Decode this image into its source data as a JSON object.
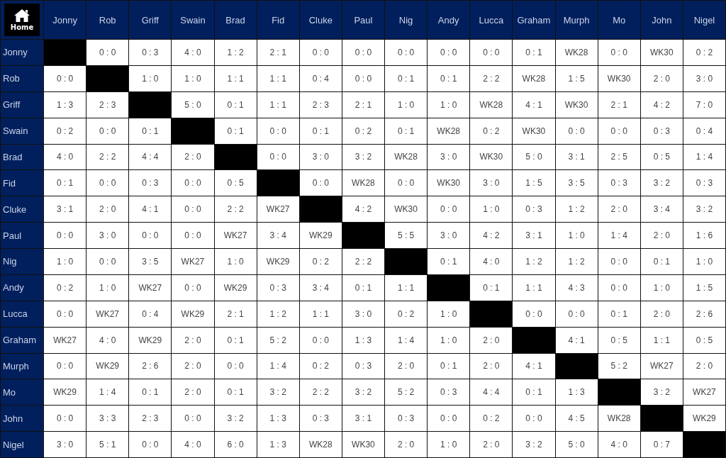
{
  "home_button": {
    "label": "Home"
  },
  "columns": [
    "Jonny",
    "Rob",
    "Griff",
    "Swain",
    "Brad",
    "Fid",
    "Cluke",
    "Paul",
    "Nig",
    "Andy",
    "Lucca",
    "Graham",
    "Murph",
    "Mo",
    "John",
    "Nigel"
  ],
  "rows": [
    {
      "name": "Jonny",
      "cells": [
        null,
        "0 : 0",
        "0 : 3",
        "4 : 0",
        "1 : 2",
        "2 : 1",
        "0 : 0",
        "0 : 0",
        "0 : 0",
        "0 : 0",
        "0 : 0",
        "0 : 1",
        "WK28",
        "0 : 0",
        "WK30",
        "0 : 2"
      ]
    },
    {
      "name": "Rob",
      "cells": [
        "0 : 0",
        null,
        "1 : 0",
        "1 : 0",
        "1 : 1",
        "1 : 1",
        "0 : 4",
        "0 : 0",
        "0 : 1",
        "0 : 1",
        "2 : 2",
        "WK28",
        "1 : 5",
        "WK30",
        "2 : 0",
        "3 : 0"
      ]
    },
    {
      "name": "Griff",
      "cells": [
        "1 : 3",
        "2 : 3",
        null,
        "5 : 0",
        "0 : 1",
        "1 : 1",
        "2 : 3",
        "2 : 1",
        "1 : 0",
        "1 : 0",
        "WK28",
        "4 : 1",
        "WK30",
        "2 : 1",
        "4 : 2",
        "7 : 0"
      ]
    },
    {
      "name": "Swain",
      "cells": [
        "0 : 2",
        "0 : 0",
        "0 : 1",
        null,
        "0 : 1",
        "0 : 0",
        "0 : 1",
        "0 : 2",
        "0 : 1",
        "WK28",
        "0 : 2",
        "WK30",
        "0 : 0",
        "0 : 0",
        "0 : 3",
        "0 : 4"
      ]
    },
    {
      "name": "Brad",
      "cells": [
        "4 : 0",
        "2 : 2",
        "4 : 4",
        "2 : 0",
        null,
        "0 : 0",
        "3 : 0",
        "3 : 2",
        "WK28",
        "3 : 0",
        "WK30",
        "5 : 0",
        "3 : 1",
        "2 : 5",
        "0 : 5",
        "1 : 4"
      ]
    },
    {
      "name": "Fid",
      "cells": [
        "0 : 1",
        "0 : 0",
        "0 : 3",
        "0 : 0",
        "0 : 5",
        null,
        "0 : 0",
        "WK28",
        "0 : 0",
        "WK30",
        "3 : 0",
        "1 : 5",
        "3 : 5",
        "0 : 3",
        "3 : 2",
        "0 : 3"
      ]
    },
    {
      "name": "Cluke",
      "cells": [
        "3 : 1",
        "2 : 0",
        "4 : 1",
        "0 : 0",
        "2 : 2",
        "WK27",
        null,
        "4 : 2",
        "WK30",
        "0 : 0",
        "1 : 0",
        "0 : 3",
        "1 : 2",
        "2 : 0",
        "3 : 4",
        "3 : 2"
      ]
    },
    {
      "name": "Paul",
      "cells": [
        "0 : 0",
        "3 : 0",
        "0 : 0",
        "0 : 0",
        "WK27",
        "3 : 4",
        "WK29",
        null,
        "5 : 5",
        "3 : 0",
        "4 : 2",
        "3 : 1",
        "1 : 0",
        "1 : 4",
        "2 : 0",
        "1 : 6"
      ]
    },
    {
      "name": "Nig",
      "cells": [
        "1 : 0",
        "0 : 0",
        "3 : 5",
        "WK27",
        "1 : 0",
        "WK29",
        "0 : 2",
        "2 : 2",
        null,
        "0 : 1",
        "4 : 0",
        "1 : 2",
        "1 : 2",
        "0 : 0",
        "0 : 1",
        "1 : 0"
      ]
    },
    {
      "name": "Andy",
      "cells": [
        "0 : 2",
        "1 : 0",
        "WK27",
        "0 : 0",
        "WK29",
        "0 : 3",
        "3 : 4",
        "0 : 1",
        "1 : 1",
        null,
        "0 : 1",
        "1 : 1",
        "4 : 3",
        "0 : 0",
        "1 : 0",
        "1 : 5"
      ]
    },
    {
      "name": "Lucca",
      "cells": [
        "0 : 0",
        "WK27",
        "0 : 4",
        "WK29",
        "2 : 1",
        "1 : 2",
        "1 : 1",
        "3 : 0",
        "0 : 2",
        "1 : 0",
        null,
        "0 : 0",
        "0 : 0",
        "0 : 1",
        "2 : 0",
        "2 : 6"
      ]
    },
    {
      "name": "Graham",
      "cells": [
        "WK27",
        "4 : 0",
        "WK29",
        "2 : 0",
        "0 : 1",
        "5 : 2",
        "0 : 0",
        "1 : 3",
        "1 : 4",
        "1 : 0",
        "2 : 0",
        null,
        "4 : 1",
        "0 : 5",
        "1 : 1",
        "0 : 5"
      ]
    },
    {
      "name": "Murph",
      "cells": [
        "0 : 0",
        "WK29",
        "2 : 6",
        "2 : 0",
        "0 : 0",
        "1 : 4",
        "0 : 2",
        "0 : 3",
        "2 : 0",
        "0 : 1",
        "2 : 0",
        "4 : 1",
        null,
        "5 : 2",
        "WK27",
        "2 : 0"
      ]
    },
    {
      "name": "Mo",
      "cells": [
        "WK29",
        "1 : 4",
        "0 : 1",
        "2 : 0",
        "0 : 1",
        "3 : 2",
        "2 : 2",
        "3 : 2",
        "5 : 2",
        "0 : 3",
        "4 : 4",
        "0 : 1",
        "1 : 3",
        null,
        "3 : 2",
        "WK27"
      ]
    },
    {
      "name": "John",
      "cells": [
        "0 : 0",
        "3 : 3",
        "2 : 3",
        "0 : 0",
        "3 : 2",
        "1 : 3",
        "0 : 3",
        "3 : 1",
        "0 : 3",
        "0 : 0",
        "0 : 2",
        "0 : 0",
        "4 : 5",
        "WK28",
        null,
        "WK29"
      ]
    },
    {
      "name": "Nigel",
      "cells": [
        "3 : 0",
        "5 : 1",
        "0 : 0",
        "4 : 0",
        "6 : 0",
        "1 : 3",
        "WK28",
        "WK30",
        "2 : 0",
        "1 : 0",
        "2 : 0",
        "3 : 2",
        "5 : 0",
        "4 : 0",
        "0 : 7",
        null
      ]
    }
  ]
}
